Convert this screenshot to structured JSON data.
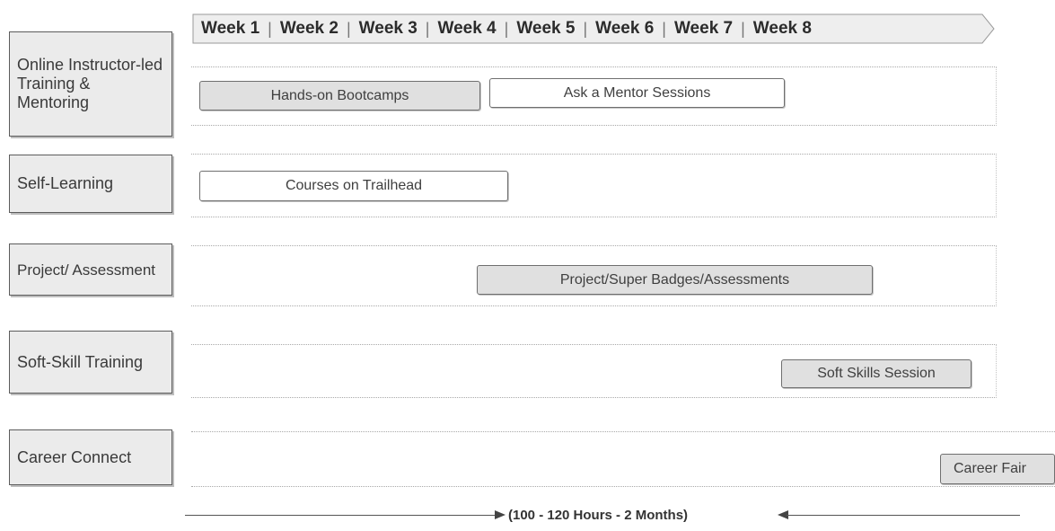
{
  "weeks": [
    "Week 1",
    "Week 2",
    "Week 3",
    "Week 4",
    "Week 5",
    "Week 6",
    "Week 7",
    "Week 8"
  ],
  "lanes": [
    {
      "label": "Online Instructor-led Training & Mentoring",
      "activities": [
        "Hands-on Bootcamps",
        "Ask a Mentor Sessions"
      ]
    },
    {
      "label": "Self-Learning",
      "activities": [
        "Courses on Trailhead"
      ]
    },
    {
      "label": "Project/ Assessment",
      "activities": [
        "Project/Super Badges/Assessments"
      ]
    },
    {
      "label": "Soft-Skill Training",
      "activities": [
        "Soft Skills Session"
      ]
    },
    {
      "label": "Career Connect",
      "activities": [
        "Career Fair"
      ]
    }
  ],
  "duration_note": "(100 - 120 Hours - 2 Months)",
  "colors": {
    "label_fill": "#ebebeb",
    "activity_fill": "#e0e0e0",
    "border": "#5c5c5c"
  }
}
